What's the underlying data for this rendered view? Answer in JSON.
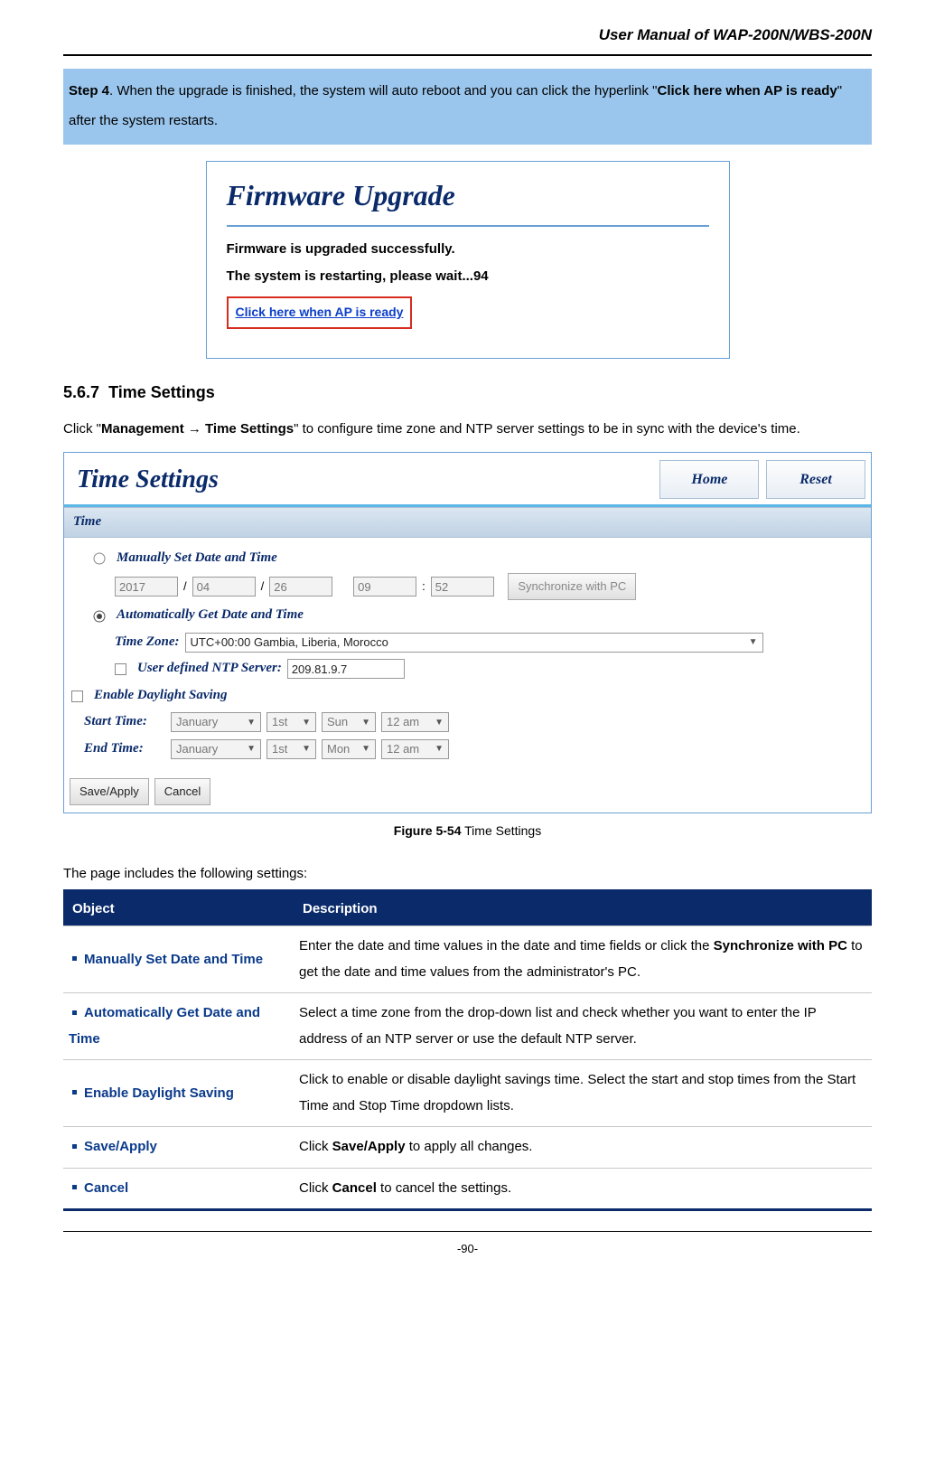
{
  "doc_title": "User Manual of WAP-200N/WBS-200N",
  "step4": {
    "prefix": "Step 4",
    "text1": ". When the upgrade is finished, the system will auto reboot and you can click the hyperlink \"",
    "bold1": "Click here when AP is ready",
    "text2": "\" after the system restarts."
  },
  "firmware": {
    "title": "Firmware Upgrade",
    "line1": "Firmware is upgraded successfully.",
    "line2": "The system is restarting, please wait...94",
    "link": "Click here when AP is ready"
  },
  "section_number": "5.6.7",
  "section_title": "Time Settings",
  "section_intro": {
    "pre": "Click \"",
    "path": "Management → Time Settings",
    "post": "\" to configure time zone and NTP server settings to be in sync with the device's time."
  },
  "ts": {
    "title": "Time Settings",
    "home": "Home",
    "reset": "Reset",
    "section_time": "Time",
    "manual_label": "Manually Set Date and Time",
    "year": "2017",
    "month": "04",
    "day": "26",
    "hour": "09",
    "minute": "52",
    "sync_pc": "Synchronize with PC",
    "auto_label": "Automatically Get Date and Time",
    "tz_label": "Time Zone:",
    "tz_value": "UTC+00:00 Gambia, Liberia, Morocco",
    "ntp_label": "User defined NTP Server:",
    "ntp_value": "209.81.9.7",
    "daylight_label": "Enable Daylight Saving",
    "start_label": "Start Time:",
    "end_label": "End Time:",
    "start_month": "January",
    "start_week": "1st",
    "start_day": "Sun",
    "start_hour": "12 am",
    "end_month": "January",
    "end_week": "1st",
    "end_day": "Mon",
    "end_hour": "12 am",
    "save_apply": "Save/Apply",
    "cancel": "Cancel"
  },
  "figure_caption": {
    "label": "Figure 5-54",
    "text": " Time Settings"
  },
  "table_intro": "The page includes the following settings:",
  "table_headers": {
    "object": "Object",
    "description": "Description"
  },
  "rows": [
    {
      "obj": "Manually Set Date and Time",
      "desc_pre": "Enter the date and time values in the date and time fields or click the ",
      "desc_bold": "Synchronize with PC",
      "desc_post": " to get the date and time values from the administrator's PC."
    },
    {
      "obj": "Automatically Get Date and Time",
      "desc_pre": "Select a time zone from the drop-down list and check whether you want to enter the IP address of an NTP server or use the default NTP server.",
      "desc_bold": "",
      "desc_post": ""
    },
    {
      "obj": "Enable Daylight Saving",
      "desc_pre": "Click to enable or disable daylight savings time. Select the start and stop times from the Start Time and Stop Time dropdown lists.",
      "desc_bold": "",
      "desc_post": ""
    },
    {
      "obj": "Save/Apply",
      "desc_pre": "Click ",
      "desc_bold": "Save/Apply",
      "desc_post": " to apply all changes."
    },
    {
      "obj": "Cancel",
      "desc_pre": "Click ",
      "desc_bold": "Cancel",
      "desc_post": " to cancel the settings."
    }
  ],
  "page_number": "-90-"
}
